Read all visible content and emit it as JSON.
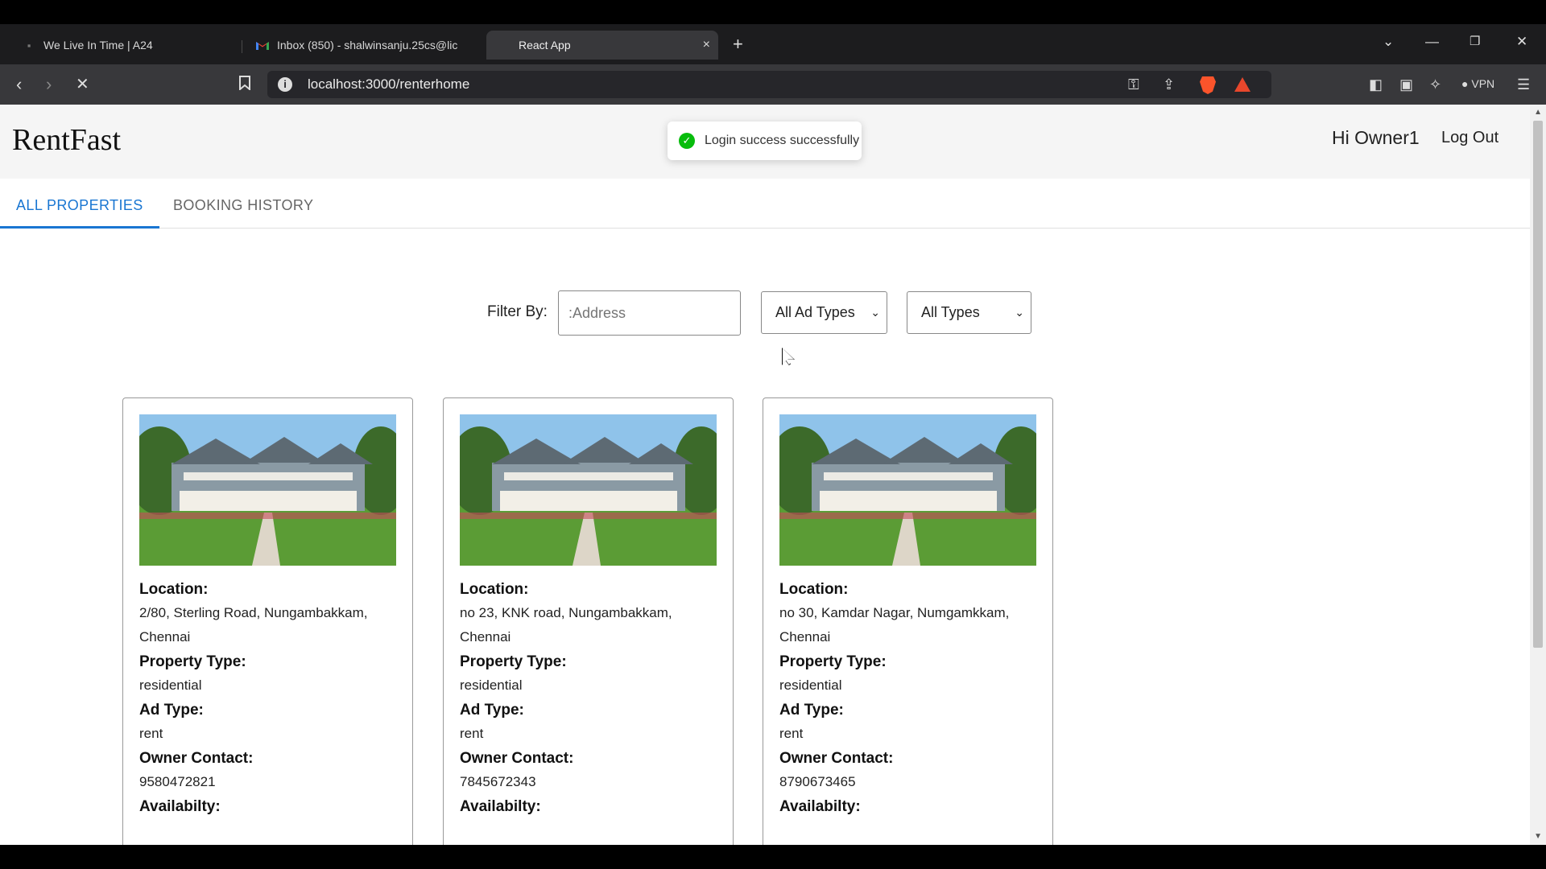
{
  "browser": {
    "tabs": [
      {
        "title": "We Live In Time | A24",
        "icon": "a24-icon"
      },
      {
        "title": "Inbox (850) - shalwinsanju.25cs@lic",
        "icon": "gmail-icon"
      },
      {
        "title": "React App",
        "icon": "react-icon",
        "close": "×"
      }
    ],
    "new_tab": "+",
    "url": "localhost:3000/renterhome",
    "vpn_label": "VPN"
  },
  "app": {
    "brand": "RentFast",
    "greeting": "Hi Owner1",
    "logout": "Log Out",
    "toast": "Login success successfully",
    "accent": "#1976d2"
  },
  "tabs": [
    {
      "label": "ALL PROPERTIES",
      "active": true
    },
    {
      "label": "BOOKING HISTORY",
      "active": false
    }
  ],
  "filters": {
    "label": "Filter By:",
    "address_placeholder": ":Address",
    "ad_type": "All Ad Types",
    "type": "All Types"
  },
  "properties": [
    {
      "location_label": "Location:",
      "location": "2/80, Sterling Road, Nungambakkam, Chennai",
      "type_label": "Property Type:",
      "type": "residential",
      "ad_label": "Ad Type:",
      "ad": "rent",
      "contact_label": "Owner Contact:",
      "contact": "9580472821",
      "avail_label": "Availabilty:"
    },
    {
      "location_label": "Location:",
      "location": "no 23, KNK road, Nungambakkam, Chennai",
      "type_label": "Property Type:",
      "type": "residential",
      "ad_label": "Ad Type:",
      "ad": "rent",
      "contact_label": "Owner Contact:",
      "contact": "7845672343",
      "avail_label": "Availabilty:"
    },
    {
      "location_label": "Location:",
      "location": "no 30, Kamdar Nagar, Numgamkkam, Chennai",
      "type_label": "Property Type:",
      "type": "residential",
      "ad_label": "Ad Type:",
      "ad": "rent",
      "contact_label": "Owner Contact:",
      "contact": "8790673465",
      "avail_label": "Availabilty:"
    }
  ]
}
